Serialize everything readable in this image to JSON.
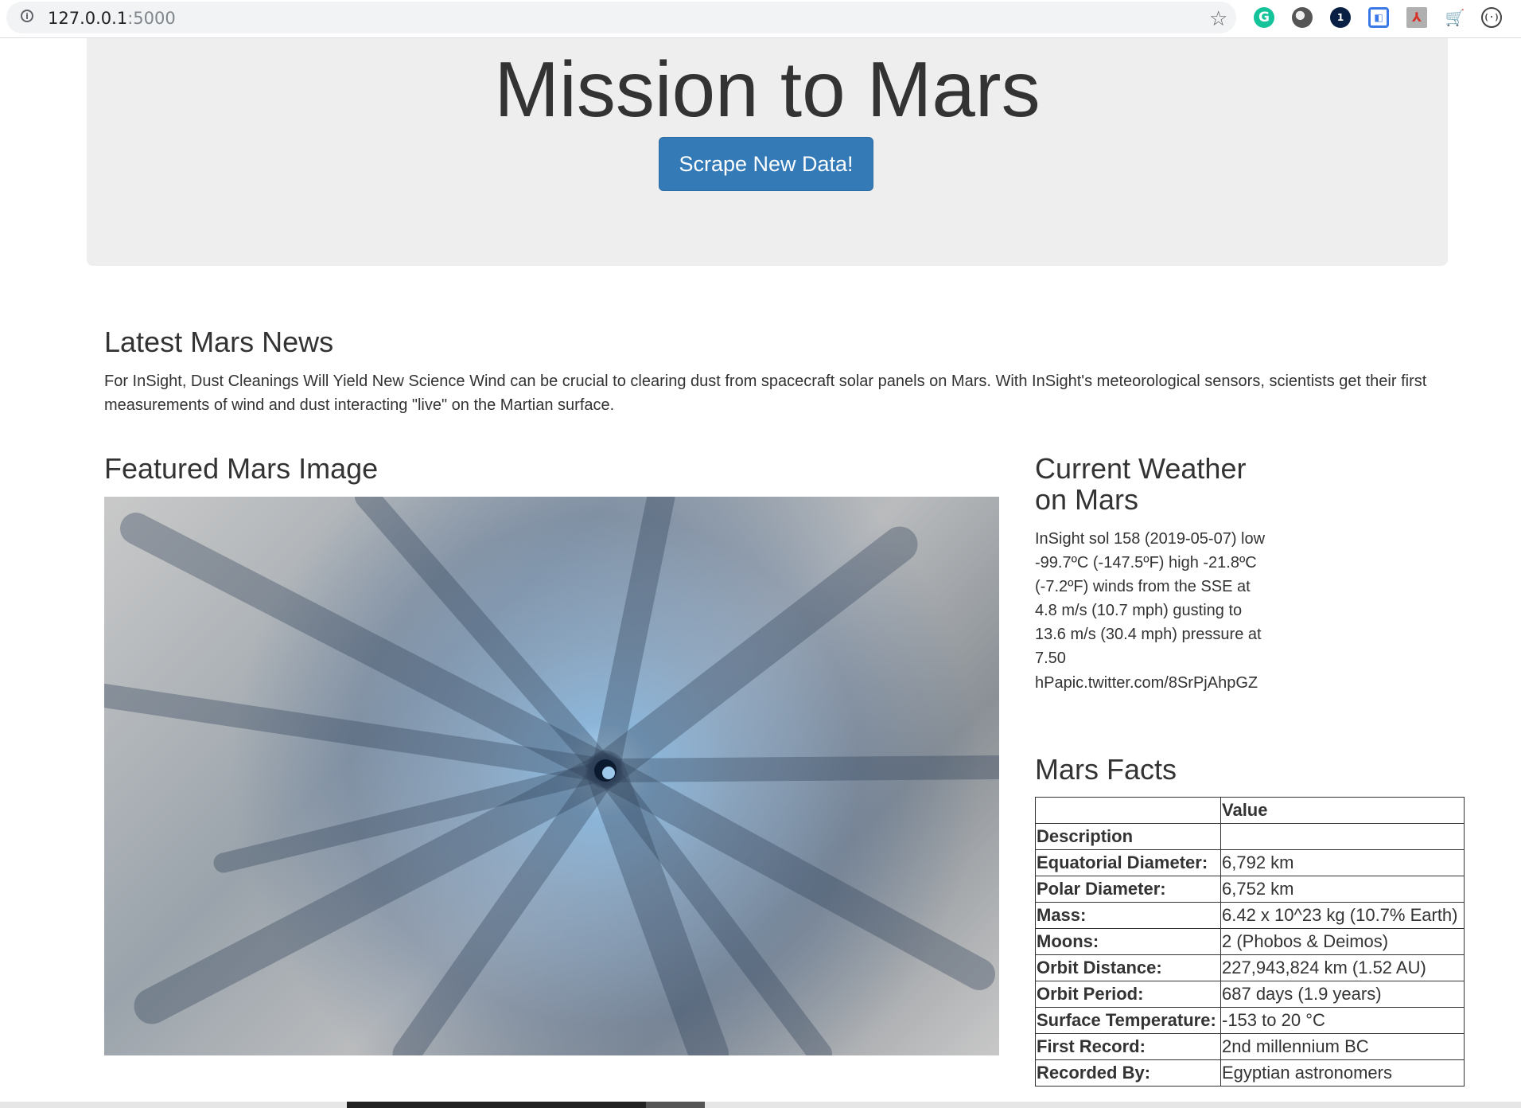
{
  "browser": {
    "url_host": "127.0.0.1",
    "url_port": ":5000",
    "icons": [
      "info-icon",
      "star-icon",
      "grammarly-icon",
      "circle-extension-icon",
      "onepassword-icon",
      "blue-extension-icon",
      "pdf-icon",
      "cart-icon",
      "code-icon"
    ],
    "onepassword_badge": "1"
  },
  "jumbotron": {
    "title": "Mission to Mars",
    "button_label": "Scrape New Data!",
    "button_color": "#337ab7",
    "background": "#eeeeee"
  },
  "news": {
    "heading": "Latest Mars News",
    "text": "For InSight, Dust Cleanings Will Yield New Science Wind can be crucial to clearing dust from spacecraft solar panels on Mars. With InSight's meteorological sensors, scientists get their first measurements of wind and dust interacting \"live\" on the Martian surface."
  },
  "featured": {
    "heading": "Featured Mars Image"
  },
  "weather": {
    "heading": "Current Weather on Mars",
    "text": "InSight sol 158 (2019-05-07) low -99.7ºC (-147.5ºF) high -21.8ºC (-7.2ºF) winds from the SSE at 4.8 m/s (10.7 mph) gusting to 13.6 m/s (30.4 mph) pressure at 7.50 hPapic.twitter.com/8SrPjAhpGZ"
  },
  "facts": {
    "heading": "Mars Facts",
    "header_value": "Value",
    "header_description": "Description",
    "rows": [
      {
        "label": "Equatorial Diameter:",
        "value": "6,792 km"
      },
      {
        "label": "Polar Diameter:",
        "value": "6,752 km"
      },
      {
        "label": "Mass:",
        "value": "6.42 x 10^23 kg (10.7% Earth)"
      },
      {
        "label": "Moons:",
        "value": "2 (Phobos & Deimos)"
      },
      {
        "label": "Orbit Distance:",
        "value": "227,943,824 km (1.52 AU)"
      },
      {
        "label": "Orbit Period:",
        "value": "687 days (1.9 years)"
      },
      {
        "label": "Surface Temperature:",
        "value": "-153 to 20 °C"
      },
      {
        "label": "First Record:",
        "value": "2nd millennium BC"
      },
      {
        "label": "Recorded By:",
        "value": "Egyptian astronomers"
      }
    ]
  }
}
